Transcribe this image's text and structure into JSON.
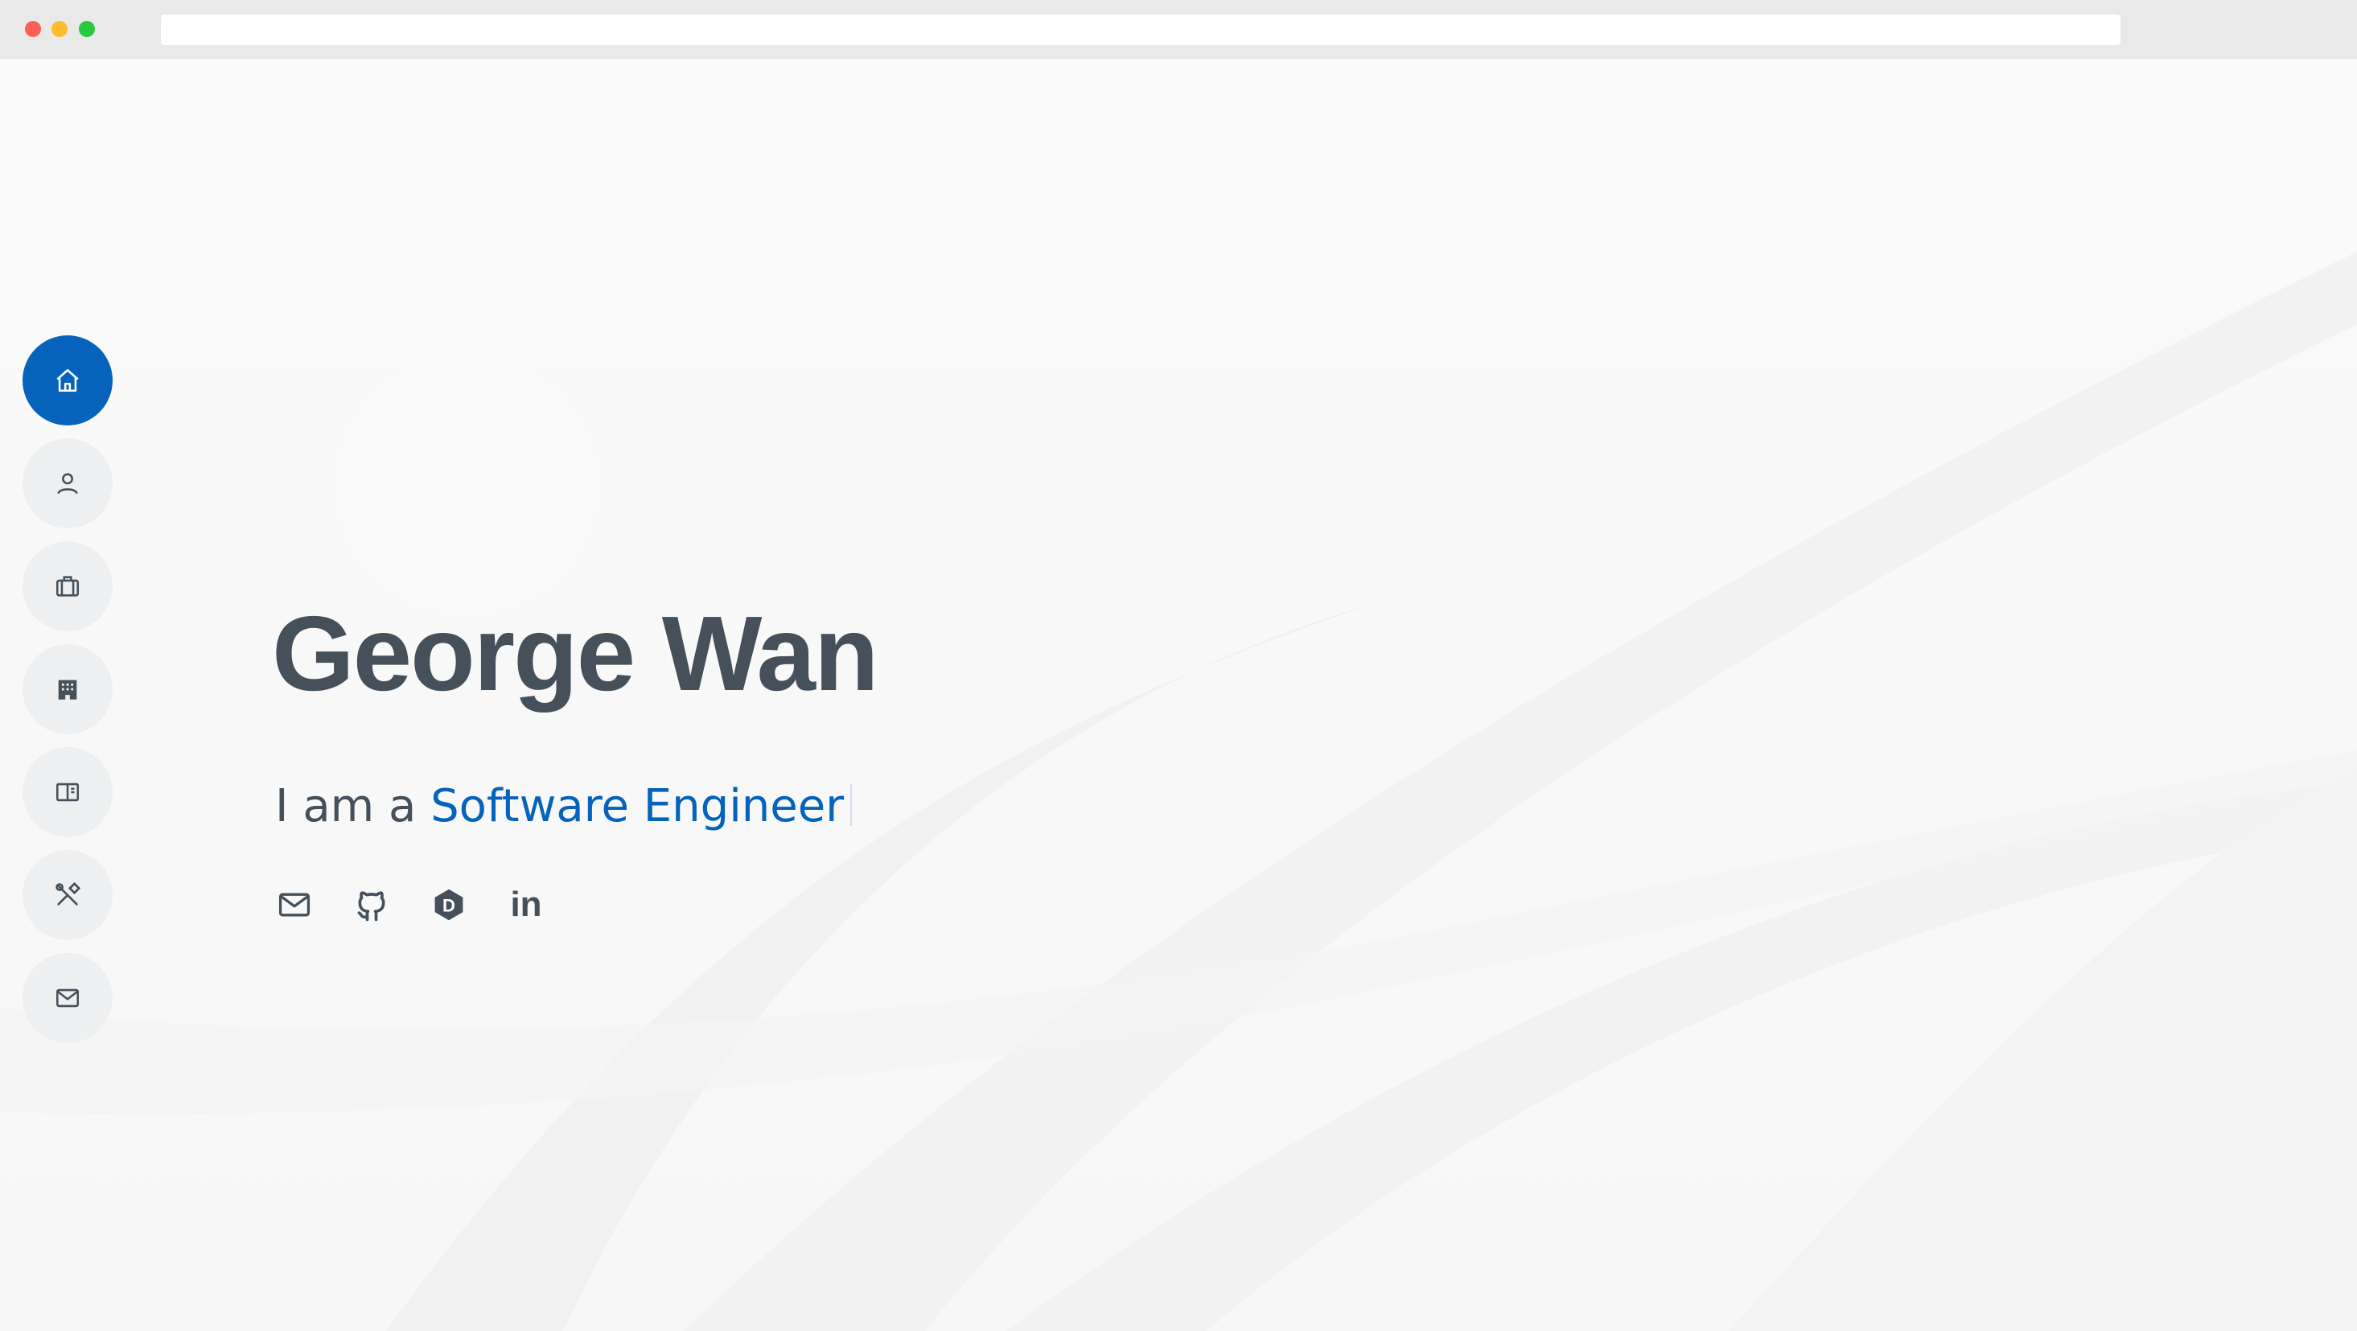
{
  "browser": {
    "url": ""
  },
  "nav": {
    "items": [
      {
        "name": "home",
        "icon": "home-icon",
        "active": true
      },
      {
        "name": "about",
        "icon": "person-icon",
        "active": false
      },
      {
        "name": "resume",
        "icon": "briefcase-icon",
        "active": false
      },
      {
        "name": "experience",
        "icon": "building-icon",
        "active": false
      },
      {
        "name": "portfolio",
        "icon": "book-icon",
        "active": false
      },
      {
        "name": "skills",
        "icon": "tools-icon",
        "active": false
      },
      {
        "name": "contact",
        "icon": "envelope-icon",
        "active": false
      }
    ]
  },
  "hero": {
    "name": "George Wan",
    "tagline_prefix": "I am a ",
    "tagline_role": "Software Engineer"
  },
  "socials": [
    {
      "name": "email",
      "icon": "envelope-icon"
    },
    {
      "name": "github",
      "icon": "github-icon"
    },
    {
      "name": "dev",
      "icon": "dev-icon",
      "glyph": "D"
    },
    {
      "name": "linkedin",
      "icon": "linkedin-icon",
      "glyph": "in"
    }
  ],
  "colors": {
    "accent": "#0563bb",
    "text": "#45505b",
    "nav_bg": "#eeeff0"
  }
}
